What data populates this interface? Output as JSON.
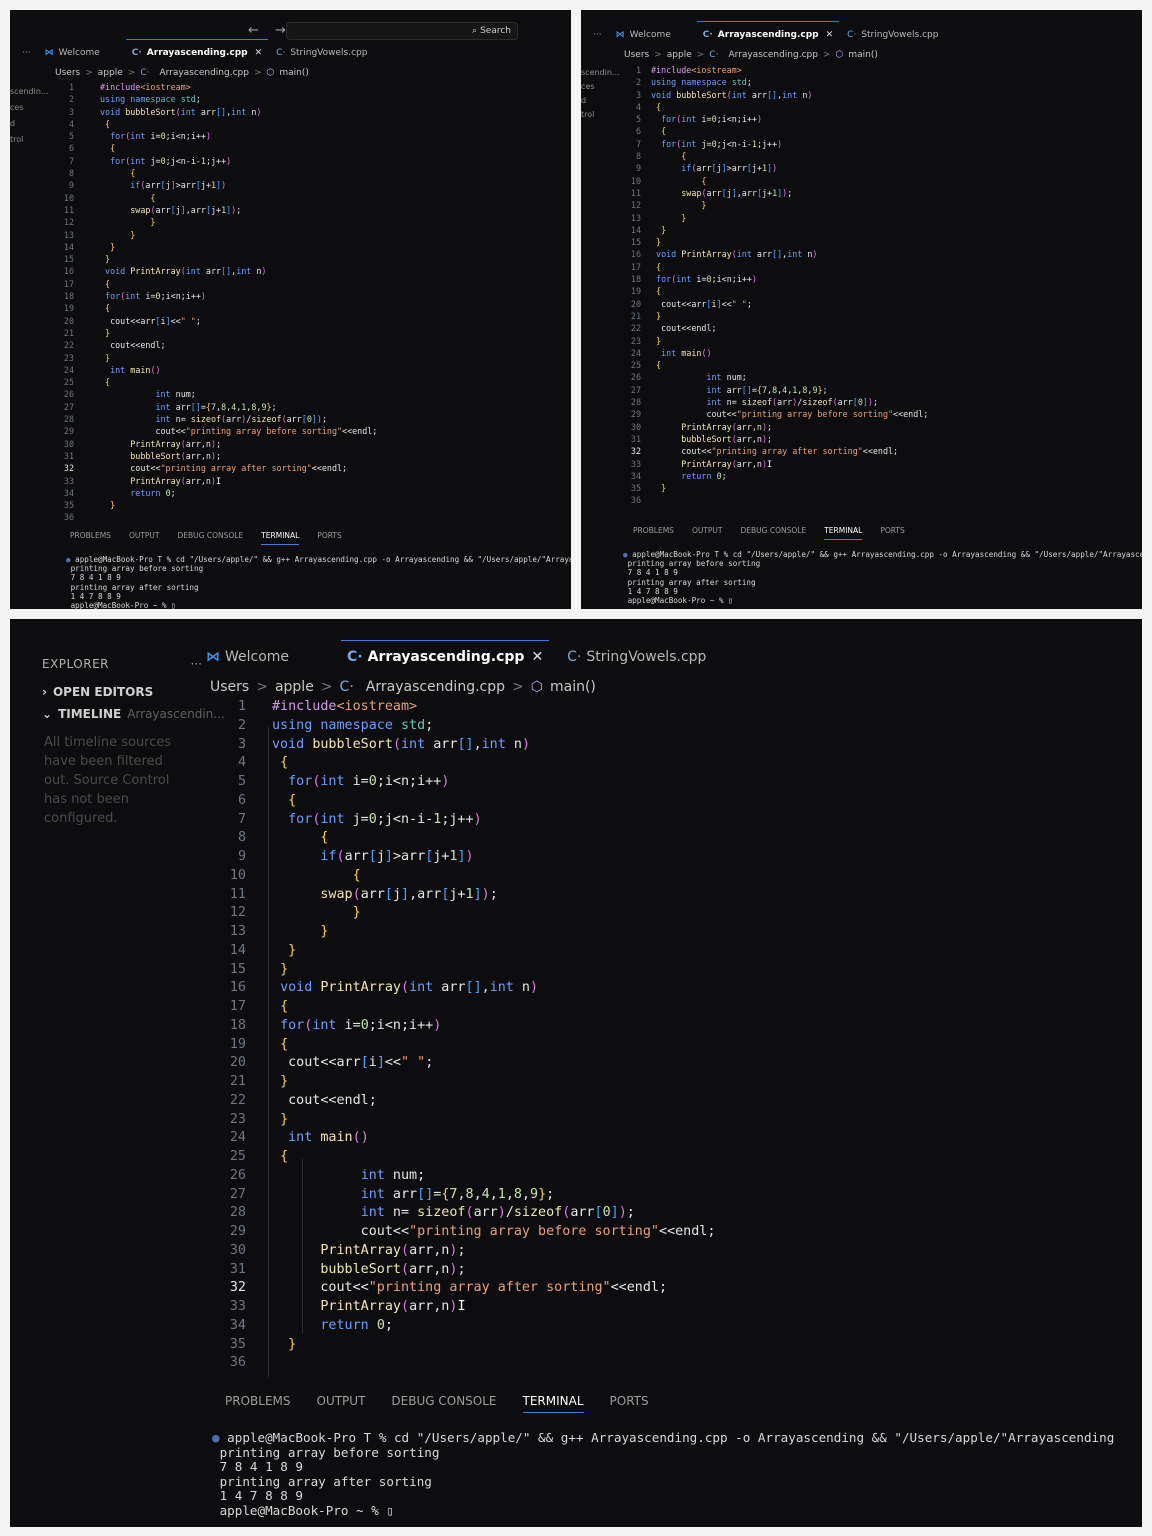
{
  "editor": {
    "tabs": {
      "welcome": "Welcome",
      "active_file": "Arrayascending.cpp",
      "other_file": "StringVowels.cpp",
      "close": "✕",
      "more": "···"
    },
    "breadcrumb": {
      "users": "Users",
      "apple": "apple",
      "file": "Arrayascending.cpp",
      "symbol": "main()"
    },
    "search": {
      "label": "Search"
    },
    "nav": {
      "back": "←",
      "forward": "→"
    },
    "sidebar_fragments": [
      "scendin...",
      "ces",
      "d",
      "trol"
    ],
    "current_line": 32,
    "code": [
      "#include<iostream>",
      "using namespace std;",
      "void bubbleSort(int arr[],int n)",
      " {",
      "  for(int i=0;i<n;i++)",
      "  {",
      "  for(int j=0;j<n-i-1;j++)",
      "      {",
      "      if(arr[j]>arr[j+1])",
      "          {",
      "      swap(arr[j],arr[j+1]);",
      "          }",
      "      }",
      "  }",
      " }",
      " void PrintArray(int arr[],int n)",
      " {",
      " for(int i=0;i<n;i++)",
      " {",
      "  cout<<arr[i]<<\" \";",
      " }",
      "  cout<<endl;",
      " }",
      "  int main()",
      " {",
      "           int num;",
      "           int arr[]={7,8,4,1,8,9};",
      "           int n= sizeof(arr)/sizeof(arr[0]);",
      "           cout<<\"printing array before sorting\"<<endl;",
      "      PrintArray(arr,n);",
      "      bubbleSort(arr,n);",
      "      cout<<\"printing array after sorting\"<<endl;",
      "      PrintArray(arr,n)",
      "      return 0;",
      "  }",
      ""
    ],
    "cursor_glyph": "I"
  },
  "bottom_panel": {
    "tabs": [
      "PROBLEMS",
      "OUTPUT",
      "DEBUG CONSOLE",
      "TERMINAL",
      "PORTS"
    ],
    "active_tab": "TERMINAL"
  },
  "terminal": {
    "lines": [
      "apple@MacBook-Pro T % cd \"/Users/apple/\" && g++ Arrayascending.cpp -o Arrayascending && \"/Users/apple/\"Arrayascending",
      "printing array before sorting",
      "7 8 4 1 8 9",
      "printing array after sorting",
      "1 4 7 8 8 9",
      "apple@MacBook-Pro ~ % ▯"
    ],
    "dot": "●"
  },
  "explorer": {
    "title": "EXPLORER",
    "more": "···",
    "open_editors": "OPEN EDITORS",
    "timeline": "TIMELINE",
    "timeline_file": "Arrayascendin...",
    "timeline_note": [
      "All timeline sources",
      "have been filtered",
      "out. Source Control",
      "has not been",
      "configured."
    ]
  }
}
